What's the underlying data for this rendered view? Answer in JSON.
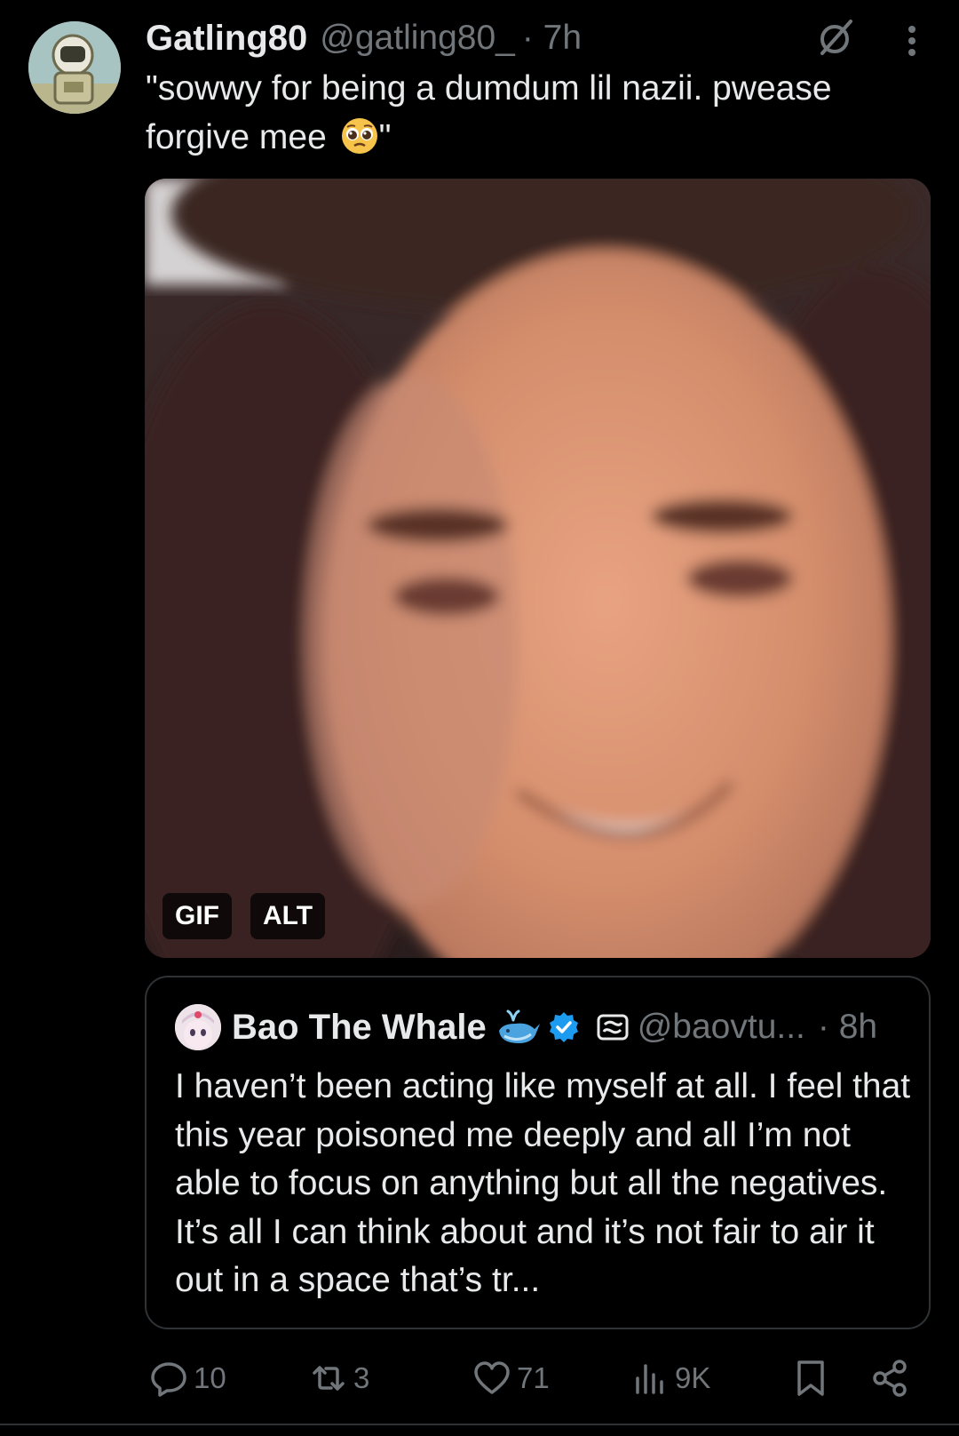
{
  "tweet": {
    "author_name": "Gatling80",
    "author_handle": "@gatling80_",
    "time": "· 7h",
    "text": "\"sowwy for being a dumdum lil nazii. pwease forgive mee ",
    "text_end": "\"",
    "emoji_icon": "pleading-face-icon",
    "media": {
      "type_badge": "GIF",
      "alt_badge": "ALT"
    }
  },
  "quote": {
    "author_name": "Bao The Whale",
    "author_handle": "@baovtu...",
    "time": "· 8h",
    "text": "I haven’t been acting like myself at all. I feel that this year poisoned me deeply and all I’m not able to focus on anything but all the negatives. It’s all I can think about and it’s not fair to air it out in a space that’s tr...",
    "icons": [
      "whale-emoji-icon",
      "verified-badge-icon",
      "subscription-icon"
    ]
  },
  "actions": {
    "replies": "10",
    "reposts": "3",
    "likes": "71",
    "views": "9K"
  },
  "colors": {
    "background": "#000000",
    "primary_text": "#e7e9ea",
    "secondary_text": "#71767b",
    "verified": "#1d9bf0",
    "border": "#2f3336"
  }
}
